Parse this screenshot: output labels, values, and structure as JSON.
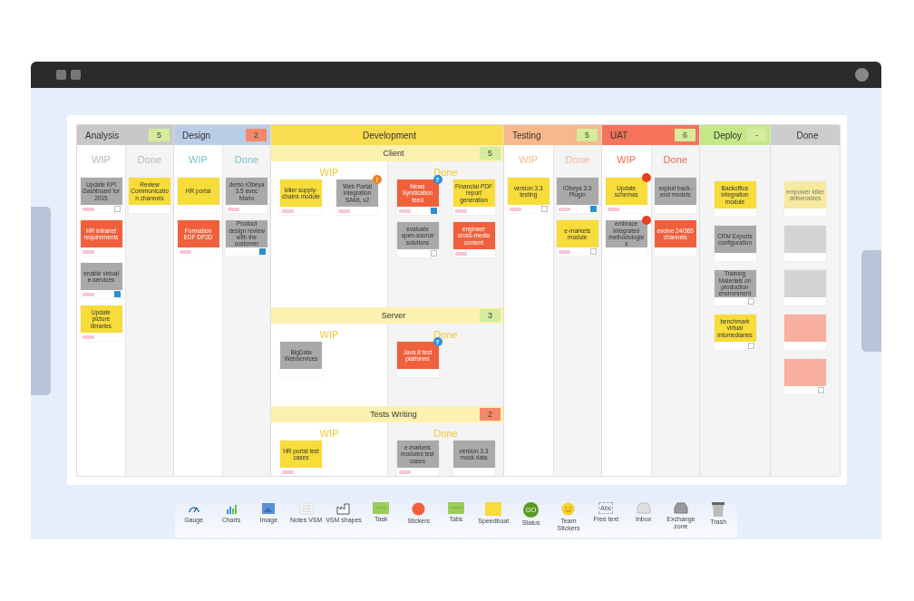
{
  "board": {
    "columns": [
      {
        "title": "Analysis",
        "count": "5",
        "over_limit": false,
        "kind": "split",
        "subcolumns": [
          {
            "label": "WIP",
            "cards": [
              {
                "title": "Update KPI Dashboard for 2015",
                "color": "#a9a9a9",
                "tag": true,
                "checked": false
              },
              {
                "title": "HR Intranet requirements",
                "color": "#f0603c",
                "tag": true
              },
              {
                "title": "enable virtual e-services",
                "color": "#a9a9a9",
                "tag": true,
                "checked": true
              },
              {
                "title": "Update picture libraries",
                "color": "#f7dc3a",
                "tag": true
              }
            ]
          },
          {
            "label": "Done",
            "cards": [
              {
                "title": "Review Communication channels",
                "color": "#f7dc3a",
                "tag": false
              }
            ]
          }
        ]
      },
      {
        "title": "Design",
        "count": "2",
        "over_limit": true,
        "kind": "split",
        "subcolumns": [
          {
            "label": "WIP",
            "cards": [
              {
                "title": "HR portal",
                "color": "#f7dc3a",
                "tag": false
              },
              {
                "title": "Formation EDF DP2D",
                "color": "#f0603c",
                "tag": true
              }
            ]
          },
          {
            "label": "Done",
            "cards": [
              {
                "title": "demo iObeya 3.5 avec Mario",
                "color": "#a9a9a9",
                "tag": true
              },
              {
                "title": "Product design review with the customer",
                "color": "#a9a9a9",
                "tag": false,
                "checked": true
              }
            ]
          }
        ]
      },
      {
        "title": "Development",
        "kind": "lanes",
        "lanes": [
          {
            "title": "Client",
            "count": "5",
            "over_limit": false,
            "subcolumns": [
              {
                "label": "WIP",
                "cards": [
                  {
                    "title": "killer supply-chains module",
                    "color": "#f7dc3a",
                    "tag": true
                  },
                  {
                    "title": "Web Portal integration SAML v2",
                    "color": "#a9a9a9",
                    "tag": true,
                    "badge": {
                      "kind": "alert",
                      "text": "!"
                    }
                  }
                ]
              },
              {
                "label": "Done",
                "cards": [
                  {
                    "title": "News Syndication feed",
                    "color": "#f0603c",
                    "tag": true,
                    "checked": true,
                    "badge": {
                      "kind": "question",
                      "text": "?"
                    }
                  },
                  {
                    "title": "Financial PDF report generation",
                    "color": "#f7dc3a",
                    "tag": true
                  },
                  {
                    "title": "evaluate open-source solutions",
                    "color": "#a9a9a9",
                    "tag": false,
                    "checked": false
                  },
                  {
                    "title": "engineer cross-media content",
                    "color": "#f0603c",
                    "tag": true
                  }
                ]
              }
            ]
          },
          {
            "title": "Server",
            "count": "3",
            "over_limit": false,
            "subcolumns": [
              {
                "label": "WIP",
                "cards": [
                  {
                    "title": "BigData Webservices",
                    "color": "#a9a9a9",
                    "tag": false
                  }
                ]
              },
              {
                "label": "Done",
                "cards": [
                  {
                    "title": "Java 8 test platforms",
                    "color": "#f0603c",
                    "tag": false,
                    "badge": {
                      "kind": "question",
                      "text": "?"
                    }
                  }
                ]
              }
            ]
          },
          {
            "title": "Tests Writing",
            "count": "2",
            "over_limit": true,
            "subcolumns": [
              {
                "label": "WIP",
                "cards": [
                  {
                    "title": "HR portal test cases",
                    "color": "#f7dc3a",
                    "tag": true
                  }
                ]
              },
              {
                "label": "Done",
                "cards": [
                  {
                    "title": "e-markets modules test cases",
                    "color": "#a9a9a9",
                    "tag": true
                  },
                  {
                    "title": "version 3.3 mock data",
                    "color": "#a9a9a9",
                    "tag": false
                  }
                ]
              }
            ]
          }
        ]
      },
      {
        "title": "Testing",
        "count": "5",
        "over_limit": false,
        "kind": "split",
        "subcolumns": [
          {
            "label": "WIP",
            "cards": [
              {
                "title": "version 3.3 testing",
                "color": "#f7dc3a",
                "tag": true,
                "checked": false
              }
            ]
          },
          {
            "label": "Done",
            "cards": [
              {
                "title": "iObeya 3.3 Plugin",
                "color": "#a9a9a9",
                "tag": true,
                "checked": true
              },
              {
                "title": "e-markets module",
                "color": "#f7dc3a",
                "tag": true,
                "checked": false
              }
            ]
          }
        ]
      },
      {
        "title": "UAT",
        "count": "6",
        "over_limit": false,
        "kind": "split",
        "subcolumns": [
          {
            "label": "WIP",
            "cards": [
              {
                "title": "Update schemas",
                "color": "#f7dc3a",
                "tag": true,
                "badge": {
                  "kind": "blocked"
                }
              },
              {
                "title": "embrace integrated methodologies",
                "color": "#a9a9a9",
                "tag": false,
                "badge": {
                  "kind": "blocked"
                }
              }
            ]
          },
          {
            "label": "Done",
            "cards": [
              {
                "title": "exploit back-end models",
                "color": "#a9a9a9",
                "tag": false
              },
              {
                "title": "evolve 24/365 channels",
                "color": "#f0603c",
                "tag": false
              }
            ]
          }
        ]
      },
      {
        "title": "Deploy",
        "count": "-",
        "over_limit": false,
        "kind": "single",
        "cards": [
          {
            "title": "Backoffice integration module",
            "color": "#f7dc3a",
            "tag": false
          },
          {
            "title": "CRM Exports configuration",
            "color": "#a9a9a9",
            "tag": false
          },
          {
            "title": "Training Materials on production environment",
            "color": "#a9a9a9",
            "tag": false,
            "checked": false
          },
          {
            "title": "benchmark virtual infomediaries",
            "color": "#f7dc3a",
            "tag": false,
            "checked": false
          }
        ]
      },
      {
        "title": "Done",
        "kind": "single",
        "cards": [
          {
            "title": "empower killer deliverables",
            "color": "#f5eaa0",
            "tag": false
          },
          {
            "color": "#d4d4d4",
            "tag": false
          },
          {
            "color": "#d4d4d4",
            "tag": false
          },
          {
            "color": "#f7b0a0",
            "tag": false
          },
          {
            "color": "#f7b0a0",
            "tag": false,
            "checked": false
          }
        ]
      }
    ]
  },
  "toolbar": [
    {
      "label": "Gauge",
      "kind": "gauge"
    },
    {
      "label": "Charts",
      "kind": "chart"
    },
    {
      "label": "Image",
      "kind": "image"
    },
    {
      "label": "Notes VSM",
      "kind": "lines"
    },
    {
      "label": "VSM shapes",
      "kind": "factory"
    },
    {
      "label": "Task",
      "kind": "card"
    },
    {
      "label": "Stickers",
      "kind": "dot"
    },
    {
      "label": "Tabs",
      "kind": "card"
    },
    {
      "label": "Speedboat",
      "kind": "note"
    },
    {
      "label": "Status",
      "kind": "status",
      "icon_text": "GO"
    },
    {
      "label": "Team Stickers",
      "kind": "smiley"
    },
    {
      "label": "Free text",
      "kind": "text",
      "icon_text": "Abc"
    },
    {
      "label": "Inbox",
      "kind": "inbox"
    },
    {
      "label": "Exchange zone",
      "kind": "tray"
    },
    {
      "label": "Trash",
      "kind": "trash"
    }
  ]
}
